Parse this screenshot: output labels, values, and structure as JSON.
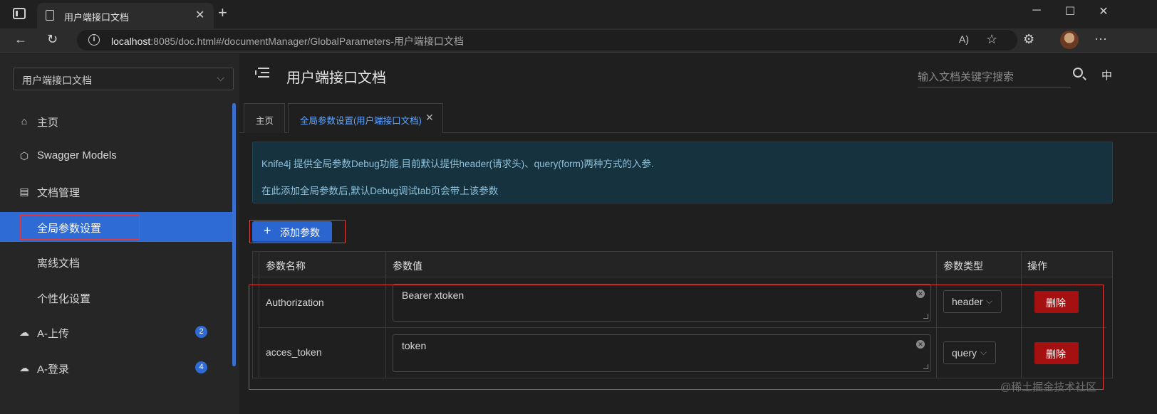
{
  "browser": {
    "tab_title": "用户端接口文档",
    "url_host": "localhost",
    "url_rest": ":8085/doc.html#/documentManager/GlobalParameters-用户端接口文档",
    "new_tab": "+",
    "tab_close": "✕",
    "win_minimize": "─",
    "win_maximize": "☐",
    "win_close": "✕",
    "more": "···",
    "read_aloud": "A)",
    "favorite": "☆",
    "extensions": "⚙"
  },
  "sidebar": {
    "doc_select": "用户端接口文档",
    "items": [
      {
        "label": "主页",
        "icon": "home-icon",
        "glyph": "⌂"
      },
      {
        "label": "Swagger Models",
        "icon": "model-icon",
        "glyph": "⬡"
      },
      {
        "label": "文档管理",
        "icon": "document-manage-icon",
        "glyph": "▤"
      },
      {
        "label": "全局参数设置",
        "active": true
      },
      {
        "label": "离线文档"
      },
      {
        "label": "个性化设置"
      },
      {
        "label": "A-上传",
        "icon": "cloud-icon",
        "glyph": "☁",
        "badge": "2"
      },
      {
        "label": "A-登录",
        "icon": "cloud-icon",
        "glyph": "☁",
        "badge": "4"
      }
    ]
  },
  "header": {
    "title": "用户端接口文档",
    "search_placeholder": "输入文档关键字搜索",
    "lang": "中"
  },
  "tabs": [
    {
      "label": "主页"
    },
    {
      "label": "全局参数设置(用户端接口文档)",
      "close": "✕",
      "active": true
    }
  ],
  "alert": {
    "line1": "Knife4j 提供全局参数Debug功能,目前默认提供header(请求头)、query(form)两种方式的入参.",
    "line2": "在此添加全局参数后,默认Debug调试tab页会带上该参数"
  },
  "add_button": {
    "plus": "+",
    "label": "添加参数"
  },
  "table": {
    "headers": [
      "参数名称",
      "参数值",
      "参数类型",
      "操作"
    ],
    "rows": [
      {
        "name": "Authorization",
        "value": "Bearer xtoken",
        "type": "header",
        "action": "删除"
      },
      {
        "name": "acces_token",
        "value": "token",
        "type": "query",
        "action": "删除"
      }
    ]
  },
  "watermark": "@稀土掘金技术社区",
  "colors": {
    "accent": "#2f6bd5",
    "danger": "#a51010",
    "highlight": "#e23b3b",
    "alert_bg": "#16323e"
  }
}
